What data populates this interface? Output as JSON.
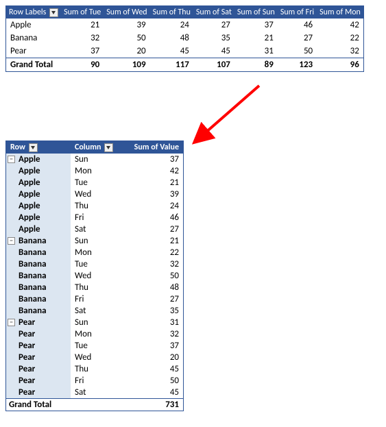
{
  "top": {
    "headers": [
      "Row Labels",
      "Sum of Tue",
      "Sum of Wed",
      "Sum of Thu",
      "Sum of Sat",
      "Sum of Sun",
      "Sum of Fri",
      "Sum of Mon"
    ],
    "rows": [
      {
        "label": "Apple",
        "vals": [
          21,
          39,
          24,
          27,
          37,
          46,
          42
        ]
      },
      {
        "label": "Banana",
        "vals": [
          32,
          50,
          48,
          35,
          21,
          27,
          22
        ]
      },
      {
        "label": "Pear",
        "vals": [
          37,
          20,
          45,
          45,
          31,
          50,
          32
        ]
      }
    ],
    "total": {
      "label": "Grand Total",
      "vals": [
        90,
        109,
        117,
        107,
        89,
        123,
        96
      ]
    }
  },
  "bottom": {
    "headers": [
      "Row",
      "Column",
      "Sum of Value"
    ],
    "groups": [
      {
        "row": "Apple",
        "items": [
          {
            "col": "Sun",
            "val": 37
          },
          {
            "col": "Mon",
            "val": 42
          },
          {
            "col": "Tue",
            "val": 21
          },
          {
            "col": "Wed",
            "val": 39
          },
          {
            "col": "Thu",
            "val": 24
          },
          {
            "col": "Fri",
            "val": 46
          },
          {
            "col": "Sat",
            "val": 27
          }
        ]
      },
      {
        "row": "Banana",
        "items": [
          {
            "col": "Sun",
            "val": 21
          },
          {
            "col": "Mon",
            "val": 22
          },
          {
            "col": "Tue",
            "val": 32
          },
          {
            "col": "Wed",
            "val": 50
          },
          {
            "col": "Thu",
            "val": 48
          },
          {
            "col": "Fri",
            "val": 27
          },
          {
            "col": "Sat",
            "val": 35
          }
        ]
      },
      {
        "row": "Pear",
        "items": [
          {
            "col": "Sun",
            "val": 31
          },
          {
            "col": "Mon",
            "val": 32
          },
          {
            "col": "Tue",
            "val": 37
          },
          {
            "col": "Wed",
            "val": 20
          },
          {
            "col": "Thu",
            "val": 45
          },
          {
            "col": "Fri",
            "val": 50
          },
          {
            "col": "Sat",
            "val": 45
          }
        ]
      }
    ],
    "total": {
      "label": "Grand Total",
      "val": 731
    }
  }
}
